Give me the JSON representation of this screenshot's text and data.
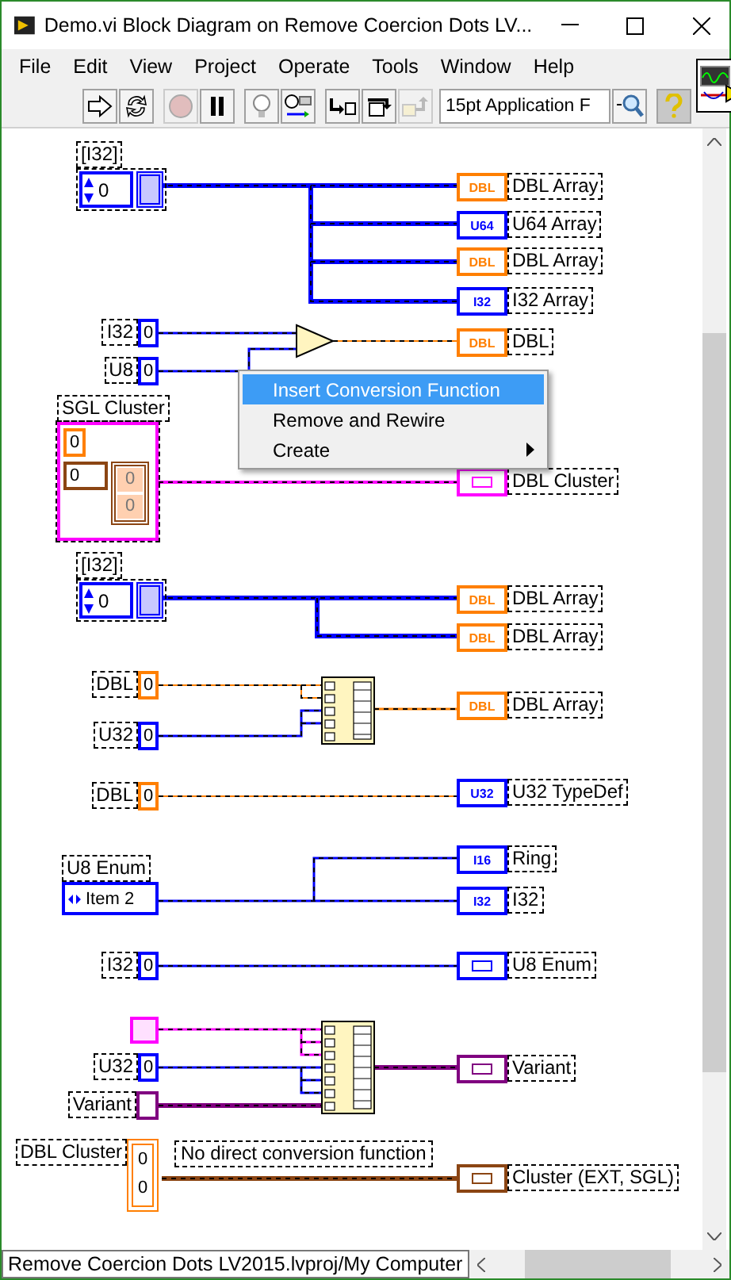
{
  "window": {
    "title": "Demo.vi Block Diagram on Remove Coercion Dots LV..."
  },
  "menu": [
    "File",
    "Edit",
    "View",
    "Project",
    "Operate",
    "Tools",
    "Window",
    "Help"
  ],
  "toolbar": {
    "buttons": [
      {
        "kind": "run",
        "disabled": false
      },
      {
        "kind": "run-continuously",
        "disabled": false
      },
      {
        "kind": "abort",
        "disabled": true
      },
      {
        "kind": "pause",
        "disabled": false
      },
      {
        "kind": "highlight",
        "disabled": false
      },
      {
        "kind": "retain-wires",
        "disabled": false
      },
      {
        "kind": "step-into",
        "disabled": false
      },
      {
        "kind": "step-over",
        "disabled": false
      },
      {
        "kind": "step-out",
        "disabled": true
      }
    ],
    "font": "15pt Application F",
    "tools": [
      {
        "kind": "search",
        "selected": false
      },
      {
        "kind": "help",
        "selected": true
      }
    ]
  },
  "diagram": {
    "controls": [
      {
        "kind": "array",
        "label": "[I32]",
        "value": "0",
        "color": "#0000ff"
      },
      {
        "kind": "numeric",
        "label": "I32",
        "value": "0",
        "color": "#0000ff"
      },
      {
        "kind": "numeric",
        "label": "U8",
        "value": "0",
        "color": "#0000ff"
      },
      {
        "kind": "cluster",
        "label": "SGL Cluster",
        "values": [
          "0",
          "0",
          "0",
          "0"
        ],
        "color": "#ff00ff"
      },
      {
        "kind": "array",
        "label": "[I32]",
        "value": "0",
        "color": "#0000ff"
      },
      {
        "kind": "numeric",
        "label": "DBL",
        "value": "0",
        "color": "#ff7f00"
      },
      {
        "kind": "numeric",
        "label": "U32",
        "value": "0",
        "color": "#0000ff"
      },
      {
        "kind": "numeric",
        "label": "DBL",
        "value": "0",
        "color": "#ff7f00"
      },
      {
        "kind": "enum",
        "label": "U8 Enum",
        "value": "Item 2",
        "color": "#0000ff"
      },
      {
        "kind": "numeric",
        "label": "I32",
        "value": "0",
        "color": "#0000ff"
      },
      {
        "kind": "cluster-constant",
        "color": "#ff00ff"
      },
      {
        "kind": "numeric",
        "label": "U32",
        "value": "0",
        "color": "#0000ff"
      },
      {
        "kind": "variant",
        "label": "Variant",
        "color": "#800080"
      },
      {
        "kind": "cluster-terminal",
        "label": "DBL Cluster",
        "values": [
          "0",
          "0"
        ],
        "color": "#ff7f00"
      }
    ],
    "indicators": [
      {
        "label": "DBL Array",
        "code": "DBL",
        "color": "#ff7f00"
      },
      {
        "label": "U64 Array",
        "code": "U64",
        "color": "#0000ff"
      },
      {
        "label": "DBL Array",
        "code": "DBL",
        "color": "#ff7f00"
      },
      {
        "label": "I32 Array",
        "code": "I32",
        "color": "#0000ff"
      },
      {
        "label": "DBL",
        "code": "DBL",
        "color": "#ff7f00"
      },
      {
        "label": "DBL Cluster",
        "color": "#ff00ff"
      },
      {
        "label": "DBL Array",
        "code": "DBL",
        "color": "#ff7f00"
      },
      {
        "label": "DBL Array",
        "code": "DBL",
        "color": "#ff7f00"
      },
      {
        "label": "DBL Array",
        "code": "DBL",
        "color": "#ff7f00"
      },
      {
        "label": "U32 TypeDef",
        "code": "U32",
        "color": "#0000ff"
      },
      {
        "label": "Ring",
        "code": "I16",
        "color": "#0000ff"
      },
      {
        "label": "I32",
        "code": "I32",
        "color": "#0000ff"
      },
      {
        "label": "U8 Enum",
        "color": "#0000ff"
      },
      {
        "label": "Variant",
        "color": "#800080"
      },
      {
        "label": "Cluster (EXT, SGL)",
        "color": "#8b4513"
      }
    ],
    "functions": [
      {
        "kind": "add"
      },
      {
        "kind": "build-array"
      },
      {
        "kind": "build-array"
      }
    ],
    "comment": "No direct conversion function"
  },
  "context_menu": {
    "items": [
      {
        "label": "Insert Conversion Function",
        "selected": true,
        "submenu": false
      },
      {
        "label": "Remove and Rewire",
        "selected": false,
        "submenu": false
      },
      {
        "label": "Create",
        "selected": false,
        "submenu": true
      }
    ]
  },
  "status_bar": {
    "path": "Remove Coercion Dots LV2015.lvproj/My Computer"
  }
}
